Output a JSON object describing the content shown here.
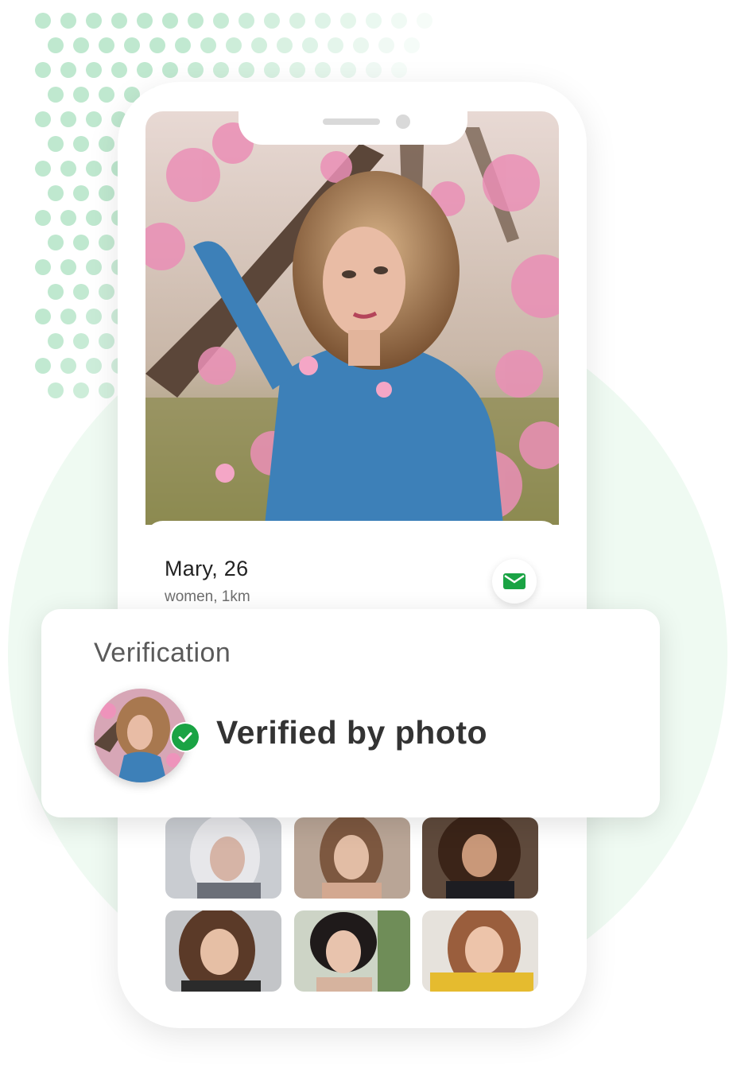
{
  "profile": {
    "name": "Mary, 26",
    "details": "women, 1km"
  },
  "verification": {
    "title": "Verification",
    "status": "Verified by photo"
  },
  "colors": {
    "accent": "#1aa344",
    "background_circle": "#effaf2",
    "dots": "#bfe8cf"
  },
  "icons": {
    "message": "envelope-icon",
    "verified": "check-circle-icon"
  },
  "gallery": {
    "count": 6
  }
}
